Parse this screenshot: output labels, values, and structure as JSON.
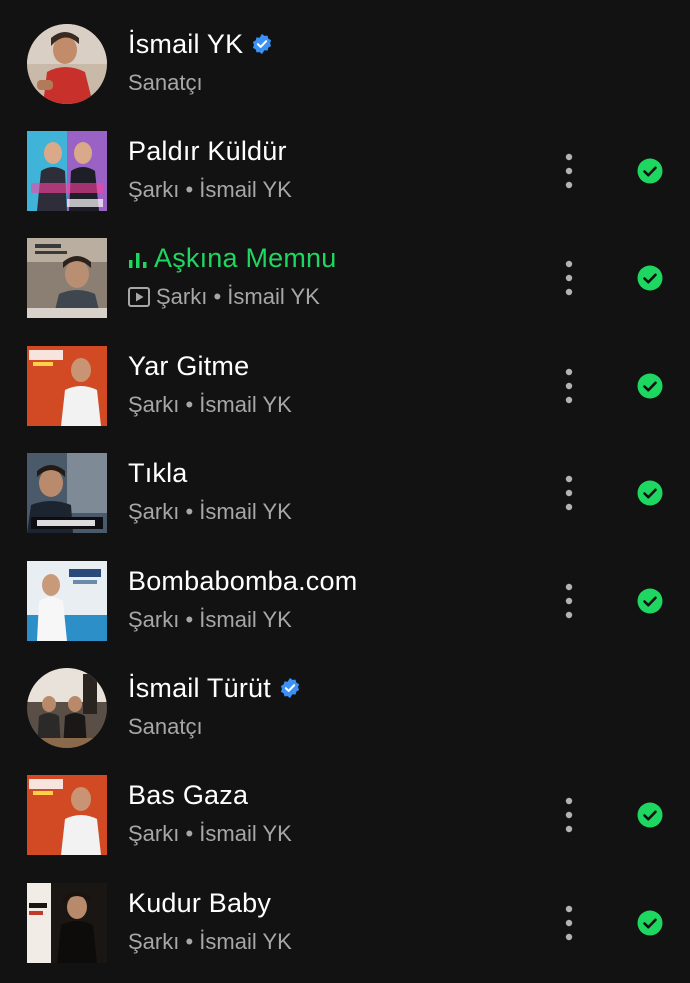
{
  "results": [
    {
      "kind": "artist",
      "title": "İsmail YK",
      "verified": true,
      "subtitle": "Sanatçı"
    },
    {
      "kind": "song",
      "title": "Paldır Küldür",
      "subtitle": "Şarkı • İsmail YK",
      "downloaded": true
    },
    {
      "kind": "song",
      "title": "Aşkına Memnu",
      "subtitle": "Şarkı • İsmail YK",
      "playing": true,
      "video": true,
      "downloaded": true
    },
    {
      "kind": "song",
      "title": "Yar Gitme",
      "subtitle": "Şarkı • İsmail YK",
      "downloaded": true
    },
    {
      "kind": "song",
      "title": "Tıkla",
      "subtitle": "Şarkı • İsmail YK",
      "downloaded": true
    },
    {
      "kind": "song",
      "title": "Bombabomba.com",
      "subtitle": "Şarkı • İsmail YK",
      "downloaded": true
    },
    {
      "kind": "artist",
      "title": "İsmail Türüt",
      "verified": true,
      "subtitle": "Sanatçı"
    },
    {
      "kind": "song",
      "title": "Bas Gaza",
      "subtitle": "Şarkı • İsmail YK",
      "downloaded": true
    },
    {
      "kind": "song",
      "title": "Kudur Baby",
      "subtitle": "Şarkı • İsmail YK",
      "downloaded": true
    }
  ],
  "colors": {
    "background": "#121212",
    "accent_green": "#1ed760",
    "verified_blue": "#3d91f4",
    "subtext": "#a7a7a7"
  },
  "icons": {
    "verified": "verified-badge-icon",
    "more": "more-options-icon",
    "downloaded": "downloaded-check-icon",
    "playing": "equalizer-icon",
    "video": "video-badge-icon"
  }
}
